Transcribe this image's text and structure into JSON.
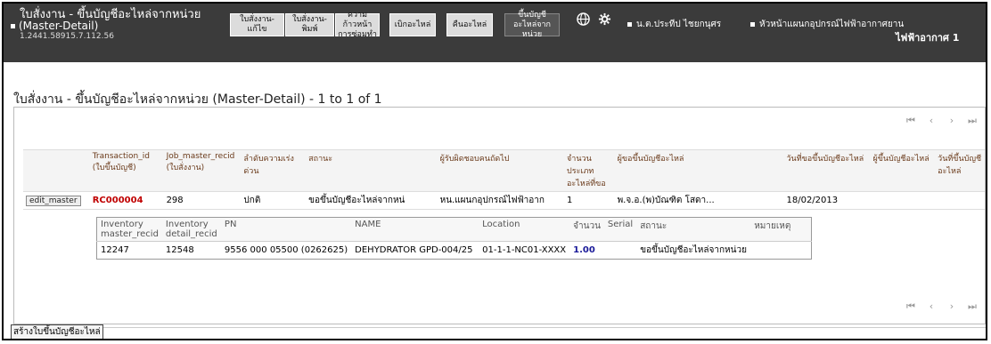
{
  "header": {
    "title_line1": "ใบสั่งงาน - ขึ้นบัญชีอะไหล่จากหน่วย",
    "title_line2": "(Master-Detail)",
    "ip": "1.2441.58915.7.112.56",
    "nav": [
      {
        "label": "ใบสั่งงาน-แก้ไข"
      },
      {
        "label": "ใบสั่งงาน-พิมพ์"
      },
      {
        "label": "ความก้าวหน้าการซ่อมทำ"
      },
      {
        "label": "เบิกอะไหล่"
      },
      {
        "label": "คืนอะไหล่"
      },
      {
        "label": "ขึ้นบัญชีอะไหล่จากหน่วย"
      }
    ],
    "user_name": "น.ต.ประทีป ไชยกนุศร",
    "role_name": "หัวหน้าแผนกอุปกรณ์ไฟฟ้าอากาศยาน",
    "role_sub": "ไฟฟ้าอากาศ 1",
    "icons": {
      "globe": "globe-icon",
      "settings": "gear-icon"
    }
  },
  "page": {
    "title": "ใบสั่งงาน - ขึ้นบัญชีอะไหล่จากหน่วย (Master-Detail) - 1 to 1 of 1",
    "create_link": "สร้างใบขึ้นบัญชีอะไหล่"
  },
  "pager": {
    "first": "⏮",
    "prev": "‹",
    "next": "›",
    "last": "⏭"
  },
  "master": {
    "columns": [
      "Transaction_id (ใบขึ้นบัญชี)",
      "Job_master_recid (ใบสั่งงาน)",
      "ลำดับความเร่งด่วน",
      "สถานะ",
      "ผู้รับผิดชอบคนถัดไป",
      "จำนวนประเภทอะไหล่ที่ขอ",
      "ผู้ขอขึ้นบัญชีอะไหล่",
      "วันที่ขอขึ้นบัญชีอะไหล่",
      "ผู้ขึ้นบัญชีอะไหล่",
      "วันที่ขึ้นบัญชีอะไหล่"
    ],
    "row": {
      "edit_label": "edit_master",
      "transaction_id": "RC000004",
      "job_master_recid": "298",
      "priority": "ปกติ",
      "status": "ขอขึ้นบัญชีอะไหล่จากหน่",
      "next_responsible": "หน.แผนกอุปกรณ์ไฟฟ้าอาก",
      "part_type_count": "1",
      "requester": "พ.จ.อ.(พ)บัณฑิต โสดา...",
      "request_date": "18/02/2013",
      "approver": "",
      "approve_date": ""
    }
  },
  "detail": {
    "columns": [
      "Inventory master_recid",
      "Inventory detail_recid",
      "PN",
      "NAME",
      "Location",
      "จำนวน",
      "Serial",
      "สถานะ",
      "หมายเหตุ"
    ],
    "row": {
      "inv_master": "12247",
      "inv_detail": "12548",
      "pn": "9556 000 05500 (0262625)",
      "name": "DEHYDRATOR GPD-004/25",
      "location": "01-1-1-NC01-XXXX",
      "qty": "1.00",
      "serial": "",
      "status": "ขอขึ้นบัญชีอะไหล่จากหน่วย",
      "remark": ""
    }
  }
}
